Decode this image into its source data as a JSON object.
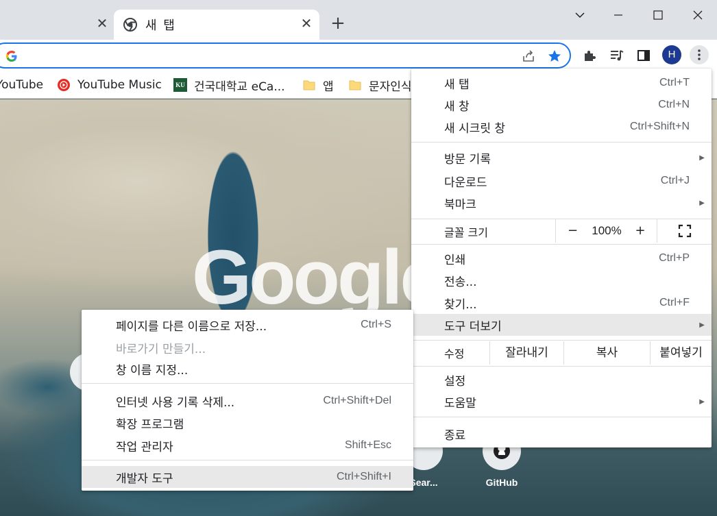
{
  "tabs": {
    "active_title": "새 탭",
    "close_glyph": "✕",
    "new_tab_glyph": "+"
  },
  "omnibox": {
    "value": "",
    "placeholder": ""
  },
  "profile": {
    "initial": "H"
  },
  "bookmarks": [
    {
      "label": "YouTube",
      "icon": "youtube-icon"
    },
    {
      "label": "YouTube Music",
      "icon": "youtube-music-icon"
    },
    {
      "label": "건국대학교 eCa...",
      "icon": "konkuk-icon",
      "icon_text": "KU"
    },
    {
      "label": "앱",
      "icon": "folder-icon"
    },
    {
      "label": "문자인식",
      "icon": "folder-icon"
    }
  ],
  "ntp": {
    "logo": "Google",
    "shortcuts": [
      {
        "label": "Sear...",
        "icon": "search-icon"
      },
      {
        "label": "GitHub",
        "icon": "github-icon"
      }
    ]
  },
  "main_menu": {
    "new_tab": {
      "label": "새 탭",
      "shortcut": "Ctrl+T"
    },
    "new_window": {
      "label": "새 창",
      "shortcut": "Ctrl+N"
    },
    "incognito": {
      "label": "새 시크릿 창",
      "shortcut": "Ctrl+Shift+N"
    },
    "history": {
      "label": "방문 기록"
    },
    "downloads": {
      "label": "다운로드",
      "shortcut": "Ctrl+J"
    },
    "bookmarks": {
      "label": "북마크"
    },
    "zoom": {
      "label": "글꼴 크기",
      "minus": "−",
      "value": "100%",
      "plus": "+"
    },
    "print": {
      "label": "인쇄",
      "shortcut": "Ctrl+P"
    },
    "cast": {
      "label": "전송..."
    },
    "find": {
      "label": "찾기...",
      "shortcut": "Ctrl+F"
    },
    "more_tools": {
      "label": "도구 더보기"
    },
    "edit": {
      "label": "수정",
      "cut": "잘라내기",
      "copy": "복사",
      "paste": "붙여넣기"
    },
    "settings": {
      "label": "설정"
    },
    "help": {
      "label": "도움말"
    },
    "exit": {
      "label": "종료"
    }
  },
  "sub_menu": {
    "save_as": {
      "label": "페이지를 다른 이름으로 저장...",
      "shortcut": "Ctrl+S"
    },
    "create_shortcut": {
      "label": "바로가기 만들기..."
    },
    "name_window": {
      "label": "창 이름 지정..."
    },
    "clear_data": {
      "label": "인터넷 사용 기록 삭제...",
      "shortcut": "Ctrl+Shift+Del"
    },
    "extensions": {
      "label": "확장 프로그램"
    },
    "task_manager": {
      "label": "작업 관리자",
      "shortcut": "Shift+Esc"
    },
    "dev_tools": {
      "label": "개발자 도구",
      "shortcut": "Ctrl+Shift+I"
    }
  },
  "colors": {
    "accent": "#1a73e8",
    "avatar": "#1c3a8f",
    "highlight": "#e8e8e8"
  }
}
